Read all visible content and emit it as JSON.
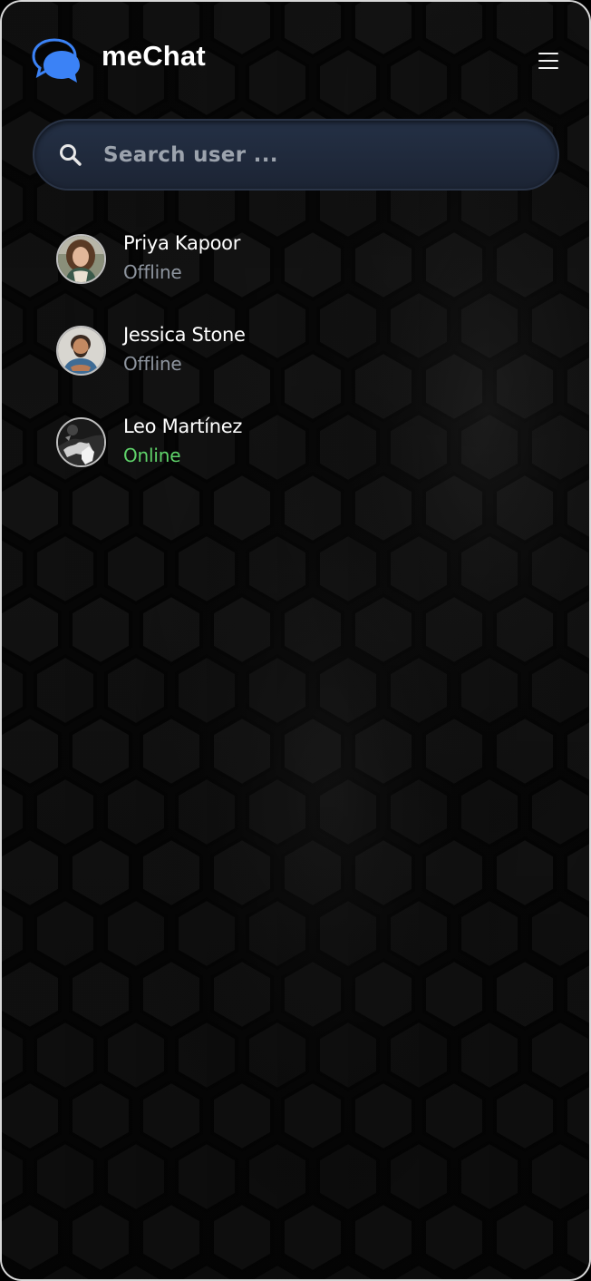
{
  "app": {
    "title": "meChat",
    "logo_icon": "chat-bubbles-icon",
    "menu_icon": "hamburger-menu-icon"
  },
  "search": {
    "placeholder": "Search user ...",
    "value": "",
    "icon": "search-icon"
  },
  "contacts": [
    {
      "name": "Priya Kapoor",
      "status": "Offline",
      "online": false
    },
    {
      "name": "Jessica Stone",
      "status": "Offline",
      "online": false
    },
    {
      "name": "Leo Martínez",
      "status": "Online",
      "online": true
    }
  ],
  "colors": {
    "accent": "#3b82f6",
    "online": "#5fd36a",
    "offline": "#8e959f",
    "background": "#0b0b0b",
    "search_bg": "#1f2838"
  }
}
